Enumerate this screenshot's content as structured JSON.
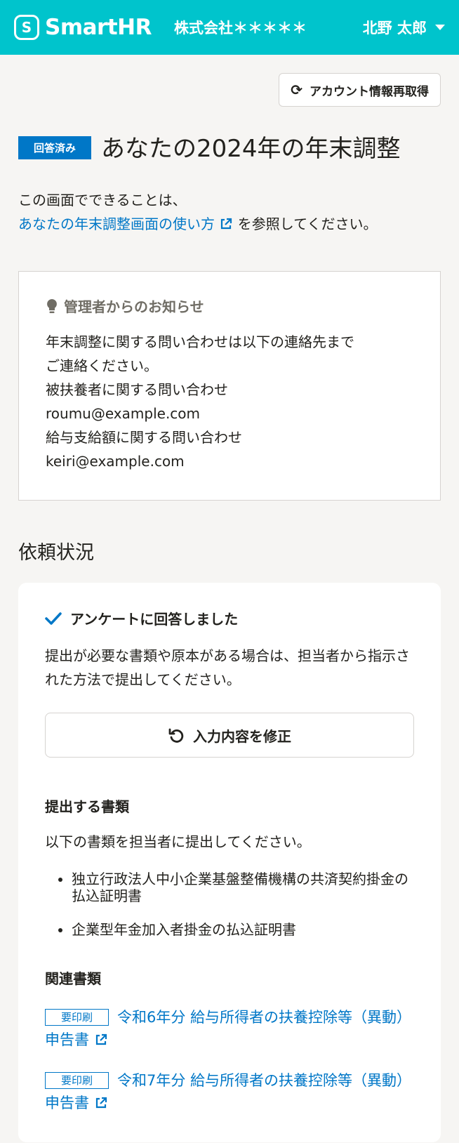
{
  "header": {
    "logo_text": "SmartHR",
    "company": "株式会社＊＊＊＊＊",
    "user_name": "北野 太郎"
  },
  "toolbar": {
    "refresh_label": "アカウント情報再取得"
  },
  "title": {
    "status_tag": "回答済み",
    "text": "あなたの2024年の年末調整"
  },
  "intro": {
    "line1": "この画面でできることは、",
    "link_text": "あなたの年末調整画面の使い方",
    "line2_suffix": "を参照してください。"
  },
  "notice": {
    "heading": "管理者からのお知らせ",
    "lines": [
      "年末調整に関する問い合わせは以下の連絡先まで",
      "ご連絡ください。",
      "被扶養者に関する問い合わせ",
      "roumu@example.com",
      "給与支給額に関する問い合わせ",
      "keiri@example.com"
    ]
  },
  "status_section": {
    "title": "依頼状況",
    "answered_label": "アンケートに回答しました",
    "description": "提出が必要な書類や原本がある場合は、担当者から指示された方法で提出してください。",
    "edit_button": "入力内容を修正",
    "submit_docs_title": "提出する書類",
    "submit_docs_desc": "以下の書類を担当者に提出してください。",
    "submit_docs": [
      "独立行政法人中小企業基盤整備機構の共済契約掛金の払込証明書",
      "企業型年金加入者掛金の払込証明書"
    ],
    "related_title": "関連書類",
    "related_docs": [
      {
        "tag": "要印刷",
        "text": "令和6年分 給与所得者の扶養控除等（異動）申告書"
      },
      {
        "tag": "要印刷",
        "text": "令和7年分 給与所得者の扶養控除等（異動）申告書"
      }
    ]
  },
  "colors": {
    "header": "#00c4cc",
    "accent": "#0077c7"
  }
}
